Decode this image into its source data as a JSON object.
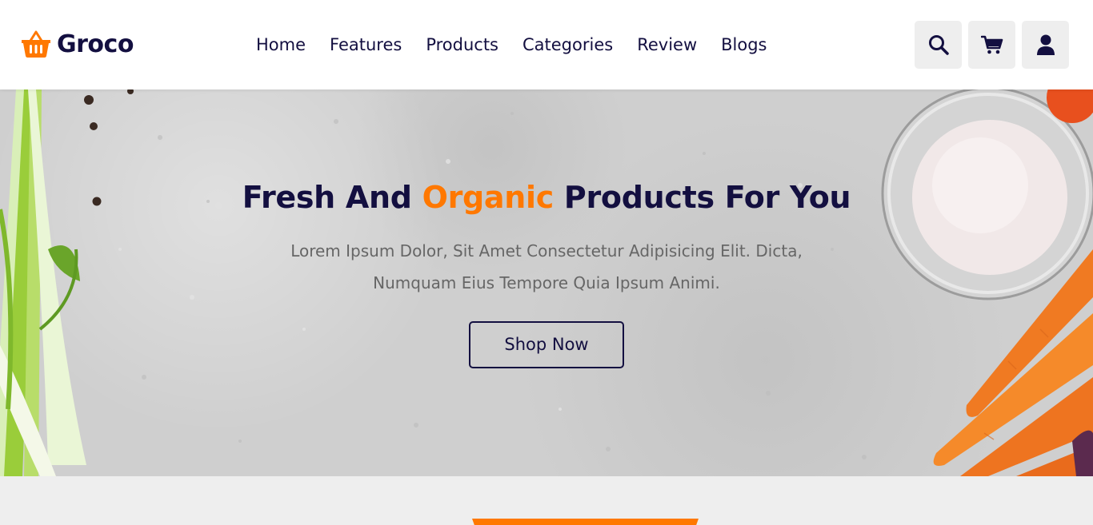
{
  "brand": {
    "name": "Groco",
    "accent_color": "#ff7800",
    "text_color": "#130f40"
  },
  "nav": {
    "items": [
      {
        "label": "Home"
      },
      {
        "label": "Features"
      },
      {
        "label": "Products"
      },
      {
        "label": "Categories"
      },
      {
        "label": "Review"
      },
      {
        "label": "Blogs"
      }
    ]
  },
  "header_icons": [
    "search-icon",
    "cart-icon",
    "user-icon"
  ],
  "hero": {
    "title_part1": "Fresh And ",
    "title_accent": "Organic",
    "title_part2": " Products For You",
    "description": "Lorem Ipsum Dolor, Sit Amet Consectetur Adipisicing Elit. Dicta, Numquam Eius Tempore Quia Ipsum Animi.",
    "button_label": "Shop Now"
  }
}
